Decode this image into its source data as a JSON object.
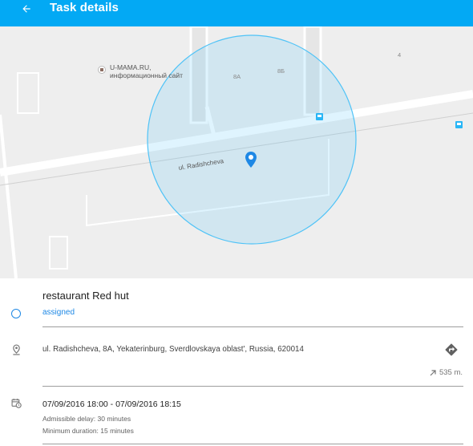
{
  "header": {
    "title": "Task details",
    "back_icon": "arrow-left-icon",
    "background": "#03a9f4"
  },
  "map": {
    "poi_name_line1": "U-MAMA.RU,",
    "poi_name_line2": "информационный сайт",
    "house_8a": "8А",
    "house_8b": "8Б",
    "house_4": "4",
    "street_name": "ul. Radishcheva",
    "geofence_color": "#4fc3f7"
  },
  "task": {
    "name": "restaurant Red hut",
    "status": "assigned",
    "status_color": "#1e88e5",
    "address": "ul. Radishcheva, 8A, Yekaterinburg, Sverdlovskaya oblast', Russia, 620014",
    "distance": "535 m.",
    "time_range": "07/09/2016 18:00 - 07/09/2016 18:15",
    "admissible_delay": "Admissible delay: 30 minutes",
    "minimum_duration": "Minimum duration: 15 minutes"
  }
}
